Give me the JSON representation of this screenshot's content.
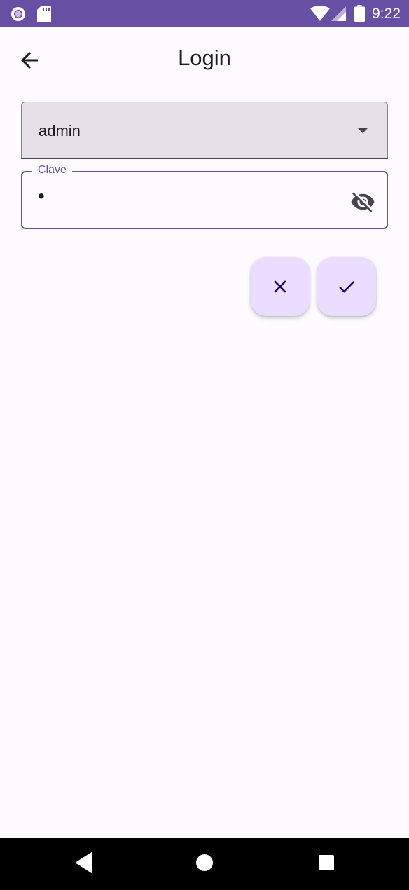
{
  "status_bar": {
    "time": "9:22",
    "icons": [
      "circle-notification-icon",
      "sd-card-icon",
      "wifi-icon",
      "signal-icon",
      "battery-icon"
    ],
    "background_color": "#6750a4"
  },
  "app_bar": {
    "title": "Login",
    "back_icon": "arrow-back-icon"
  },
  "form": {
    "user_select": {
      "value": "admin",
      "icon": "dropdown-arrow-icon"
    },
    "password": {
      "label": "Clave",
      "value": "•",
      "visibility_icon": "visibility-off-icon"
    }
  },
  "actions": {
    "cancel_icon": "close-icon",
    "confirm_icon": "check-icon",
    "fab_color": "#eaddff",
    "icon_color": "#21005d"
  },
  "nav_bar": {
    "icons": [
      "back-triangle-icon",
      "home-circle-icon",
      "recents-square-icon"
    ]
  },
  "colors": {
    "primary": "#6750a4",
    "background": "#fdfbff",
    "on_surface": "#1c1b1f"
  }
}
